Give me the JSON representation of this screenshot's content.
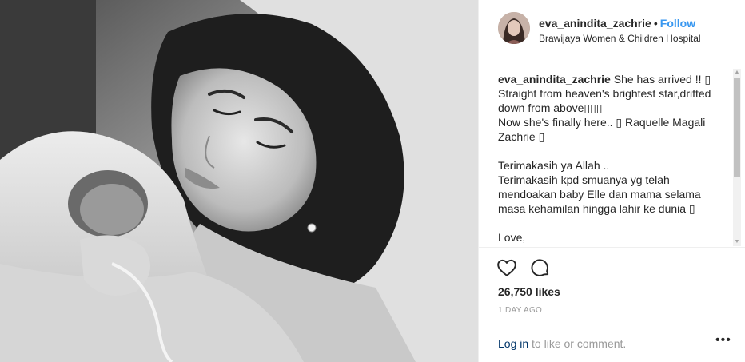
{
  "photo": {
    "alt_name": "post-photo"
  },
  "header": {
    "username": "eva_anindita_zachrie",
    "separator": "•",
    "follow_label": "Follow",
    "location": "Brawijaya Women & Children Hospital"
  },
  "caption": {
    "username": "eva_anindita_zachrie",
    "text": " She has arrived !! ▯\nStraight from heaven's brightest star,drifted down from above▯▯▯\nNow she's finally here.. ▯ Raquelle Magali Zachrie ▯\n\nTerimakasih ya Allah ..\nTerimakasih kpd smuanya yg telah mendoakan baby Elle dan mama selama masa kehamilan hingga lahir ke dunia ▯\n\nLove,\nHappy parents&brothers"
  },
  "scrollbar": {
    "up": "▲",
    "down": "▼"
  },
  "actions": {
    "like_icon": "heart-icon",
    "comment_icon": "comment-icon"
  },
  "likes": "26,750 likes",
  "age": "1 DAY AGO",
  "footer": {
    "login_label": "Log in",
    "login_suffix": " to like or comment.",
    "more_icon": "•••"
  },
  "colors": {
    "link": "#3897f0",
    "login": "#003569",
    "muted": "#999999",
    "border": "#efefef"
  }
}
